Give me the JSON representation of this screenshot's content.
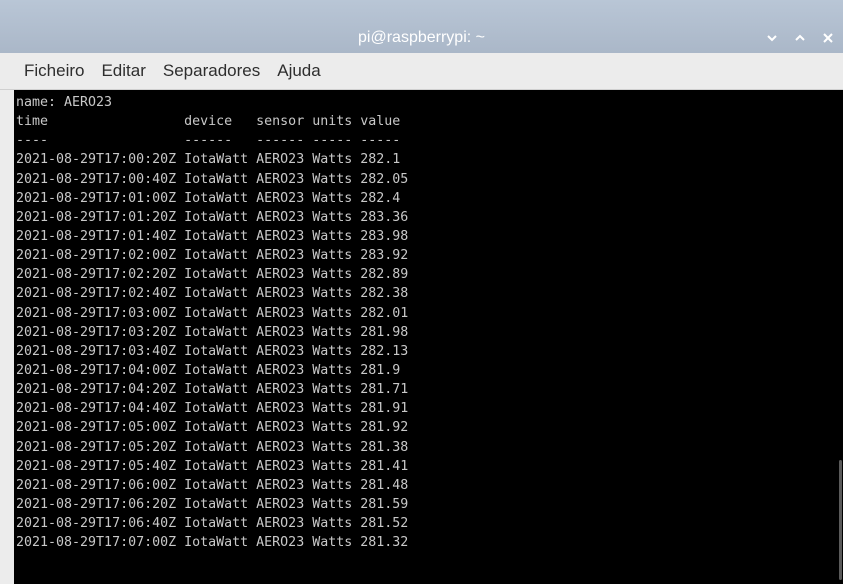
{
  "window": {
    "title": "pi@raspberrypi: ~"
  },
  "icons": {
    "minimize": "chevron-down-icon",
    "maximize": "chevron-up-icon",
    "close": "close-icon"
  },
  "menu": {
    "items": [
      "Ficheiro",
      "Editar",
      "Separadores",
      "Ajuda"
    ]
  },
  "terminal": {
    "lines": [
      "name: AERO23",
      "time                 device   sensor units value",
      "----                 ------   ------ ----- -----",
      "2021-08-29T17:00:20Z IotaWatt AERO23 Watts 282.1",
      "2021-08-29T17:00:40Z IotaWatt AERO23 Watts 282.05",
      "2021-08-29T17:01:00Z IotaWatt AERO23 Watts 282.4",
      "2021-08-29T17:01:20Z IotaWatt AERO23 Watts 283.36",
      "2021-08-29T17:01:40Z IotaWatt AERO23 Watts 283.98",
      "2021-08-29T17:02:00Z IotaWatt AERO23 Watts 283.92",
      "2021-08-29T17:02:20Z IotaWatt AERO23 Watts 282.89",
      "2021-08-29T17:02:40Z IotaWatt AERO23 Watts 282.38",
      "2021-08-29T17:03:00Z IotaWatt AERO23 Watts 282.01",
      "2021-08-29T17:03:20Z IotaWatt AERO23 Watts 281.98",
      "2021-08-29T17:03:40Z IotaWatt AERO23 Watts 282.13",
      "2021-08-29T17:04:00Z IotaWatt AERO23 Watts 281.9",
      "2021-08-29T17:04:20Z IotaWatt AERO23 Watts 281.71",
      "2021-08-29T17:04:40Z IotaWatt AERO23 Watts 281.91",
      "2021-08-29T17:05:00Z IotaWatt AERO23 Watts 281.92",
      "2021-08-29T17:05:20Z IotaWatt AERO23 Watts 281.38",
      "2021-08-29T17:05:40Z IotaWatt AERO23 Watts 281.41",
      "2021-08-29T17:06:00Z IotaWatt AERO23 Watts 281.48",
      "2021-08-29T17:06:20Z IotaWatt AERO23 Watts 281.59",
      "2021-08-29T17:06:40Z IotaWatt AERO23 Watts 281.52",
      "2021-08-29T17:07:00Z IotaWatt AERO23 Watts 281.32"
    ]
  },
  "colors": {
    "titlebar": "#b0bdcd",
    "terminal_bg": "#000000",
    "terminal_fg": "#c8c8c8",
    "menubar": "#ececec"
  }
}
